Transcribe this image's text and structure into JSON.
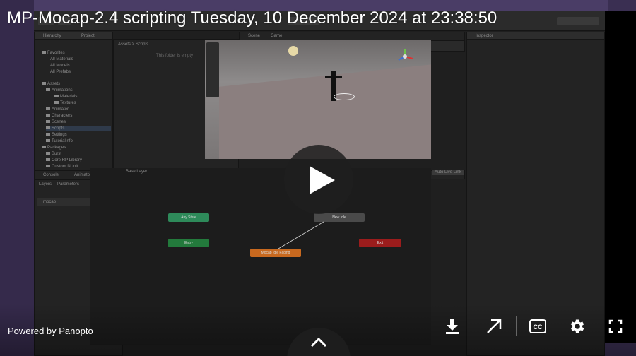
{
  "video": {
    "title": "MP-Mocap-2.4 scripting Tuesday, 10 December 2024 at 23:38:50",
    "powered_by": "Powered by Panopto"
  },
  "controls": {
    "play": "play-icon",
    "download": "download-icon",
    "popout": "arrow-up-right-icon",
    "captions": "closed-captions-icon",
    "settings": "gear-icon",
    "fullscreen": "fullscreen-icon",
    "expand": "chevron-up-icon"
  },
  "editor": {
    "hierarchy_tab": "Hierarchy",
    "project_tab": "Project",
    "scene_tab": "Scene",
    "game_tab": "Game",
    "inspector_tab": "Inspector",
    "console_tab": "Console",
    "animator_tab": "Animator",
    "layers_tab": "Layers",
    "parameters_tab": "Parameters",
    "base_layer": "Base Layer",
    "auto_live_link": "Auto Live Link",
    "param_mocap": "mocap",
    "breadcrumb": "Assets > Scripts",
    "empty_folder": "This folder is empty",
    "tree": [
      "Favorites",
      "All Materials",
      "All Models",
      "All Prefabs",
      "Assets",
      "Animations",
      "Materials",
      "Textures",
      "Animator",
      "Characters",
      "Scenes",
      "Scripts",
      "Settings",
      "TutorialInfo",
      "Packages",
      "Burst",
      "Core RP Library",
      "Custom NUnit"
    ],
    "states": {
      "any_state": "Any State",
      "entry": "Entry",
      "mocap_state": "Mocap Idle Facing",
      "exit_state": "Exit",
      "new_state": "New Idle"
    }
  },
  "colors": {
    "accent_green": "#2e8a5a",
    "accent_orange": "#c8691f",
    "accent_red": "#9b1c1c",
    "overlay_dark": "#1e1e1e"
  }
}
